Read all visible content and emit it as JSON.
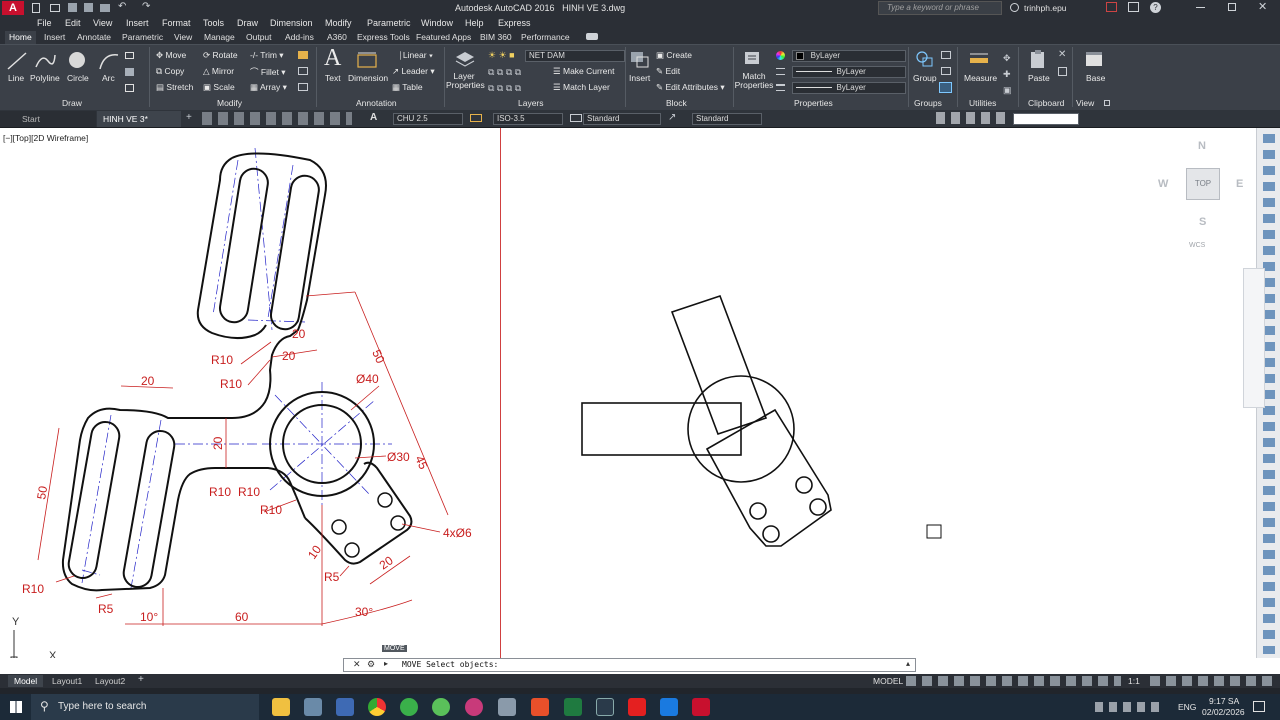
{
  "titlebar": {
    "app_title": "Autodesk AutoCAD 2016",
    "file_name": "HINH VE 3.dwg",
    "search_placeholder": "Type a keyword or phrase",
    "user": "trinhph.epu"
  },
  "menu": {
    "items": [
      "File",
      "Edit",
      "View",
      "Insert",
      "Format",
      "Tools",
      "Draw",
      "Dimension",
      "Modify",
      "Parametric",
      "Window",
      "Help",
      "Express"
    ]
  },
  "ribbon_tabs": {
    "items": [
      "Home",
      "Insert",
      "Annotate",
      "Parametric",
      "View",
      "Manage",
      "Output",
      "Add-ins",
      "A360",
      "Express Tools",
      "Featured Apps",
      "BIM 360",
      "Performance"
    ],
    "active": "Home"
  },
  "ribbon": {
    "draw": {
      "line": "Line",
      "polyline": "Polyline",
      "circle": "Circle",
      "arc": "Arc",
      "label": "Draw"
    },
    "modify": {
      "move": "Move",
      "rotate": "Rotate",
      "trim": "Trim",
      "copy": "Copy",
      "mirror": "Mirror",
      "fillet": "Fillet",
      "stretch": "Stretch",
      "scale": "Scale",
      "array": "Array",
      "label": "Modify"
    },
    "annotation": {
      "text": "Text",
      "dimension": "Dimension",
      "linear": "Linear",
      "leader": "Leader",
      "table": "Table",
      "label": "Annotation"
    },
    "layers": {
      "layer_properties_1": "Layer",
      "layer_properties_2": "Properties",
      "current_layer": "NET DAM",
      "make_current": "Make Current",
      "match_layer": "Match Layer",
      "label": "Layers"
    },
    "block": {
      "insert": "Insert",
      "create": "Create",
      "edit": "Edit",
      "edit_attributes": "Edit Attributes",
      "label": "Block"
    },
    "properties": {
      "match_1": "Match",
      "match_2": "Properties",
      "color": "ByLayer",
      "linetype": "ByLayer",
      "lineweight": "ByLayer",
      "label": "Properties"
    },
    "groups": {
      "group": "Group",
      "label": "Groups"
    },
    "utilities": {
      "measure": "Measure",
      "label": "Utilities"
    },
    "clipboard": {
      "paste": "Paste",
      "label": "Clipboard"
    },
    "view": {
      "base": "Base",
      "label": "View"
    }
  },
  "doc_tabs": {
    "start": "Start",
    "active_file": "HINH VE 3*",
    "text_style": "CHU 2.5",
    "dim_style": "ISO-3.5",
    "table_style": "Standard",
    "mleader_style": "Standard"
  },
  "viewport": {
    "label": "[−][Top][2D Wireframe]"
  },
  "viewcube": {
    "n": "N",
    "s": "S",
    "e": "E",
    "w": "W",
    "top": "TOP",
    "wcs": "WCS"
  },
  "ucs": {
    "x": "X",
    "y": "Y"
  },
  "drawing_dims": {
    "r10_a": "R10",
    "r10_b": "R10",
    "r10_c": "R10",
    "r10_d": "R10",
    "r10_e": "R10",
    "r10_f": "R10",
    "d20_a": "20",
    "d20_b": "20",
    "d20_c": "20",
    "d20_d": "20",
    "d20_e": "20",
    "d50_a": "50",
    "d50_b": "50",
    "d40": "Ø40",
    "d30": "Ø30",
    "d45": "45",
    "d10_a": "10",
    "d10_b": "10°",
    "r5_a": "R5",
    "r5_b": "R5",
    "d60": "60",
    "d30deg": "30°",
    "holes": "4xØ6"
  },
  "command": {
    "tooltip": "MOVE",
    "line": "MOVE Select objects:"
  },
  "layout_tabs": {
    "model": "Model",
    "layout1": "Layout1",
    "layout2": "Layout2"
  },
  "statusbar": {
    "model": "MODEL",
    "scale": "1:1"
  },
  "taskbar": {
    "search_placeholder": "Type here to search",
    "lang": "ENG",
    "time": "9:17 SA",
    "date": "02/02/2026"
  }
}
